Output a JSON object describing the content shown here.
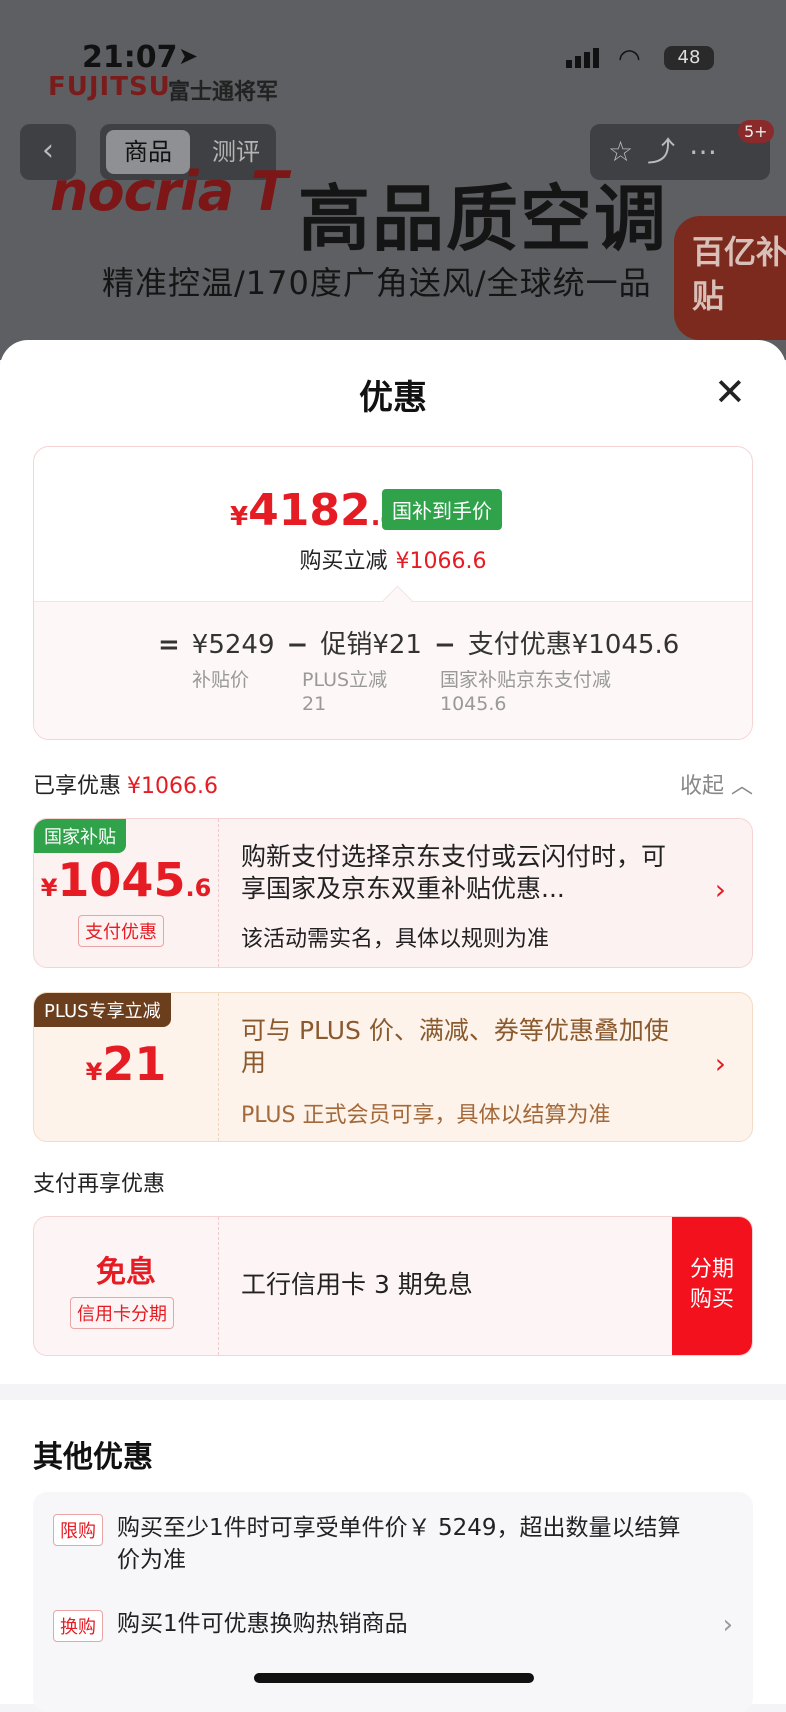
{
  "background": {
    "status_time": "21:07",
    "battery": "48",
    "brand": "FUJITSU",
    "brand_cn": "富士通将军",
    "tab_product": "商品",
    "tab_review": "测评",
    "cart_badge": "5+",
    "logo_text": "nocria T",
    "headline": "高品质空调",
    "subline": "精准控温/170度广角送风/全球统一品",
    "subsidy_tag": "百亿补贴"
  },
  "sheet": {
    "title": "优惠",
    "summary": {
      "currency": "¥",
      "final_int": "4182",
      "final_dec": ".4",
      "final_tag": "国补到手价",
      "reduce_label": "购买立减",
      "reduce_amount": "¥1066.6",
      "formula_eq": "=",
      "base_price": "¥5249",
      "minus": "−",
      "promo": "促销¥21",
      "pay_discount": "支付优惠¥1045.6",
      "base_label": "补贴价",
      "promo_label_1": "PLUS立减",
      "promo_label_2": "21",
      "pay_label_1": "国家补贴京东支付减",
      "pay_label_2": "1045.6"
    },
    "enjoyed_label": "已享优惠",
    "enjoyed_amount": "¥1066.6",
    "collapse_label": "收起",
    "subsidy_card": {
      "label": "国家补贴",
      "currency": "¥",
      "amount_int": "1045",
      "amount_dec": ".6",
      "tag": "支付优惠",
      "desc": "购新支付选择京东支付或云闪付时，可享国家及京东双重补贴优惠...",
      "note": "该活动需实名，具体以规则为准"
    },
    "plus_card": {
      "label": "PLUS专享立减",
      "currency": "¥",
      "amount": "21",
      "desc": "可与 PLUS 价、满减、券等优惠叠加使用",
      "note": "PLUS 正式会员可享，具体以结算为准"
    },
    "pay_again_title": "支付再享优惠",
    "installment_card": {
      "title": "免息",
      "tag": "信用卡分期",
      "desc": "工行信用卡 3 期免息",
      "button_line1": "分期",
      "button_line2": "购买"
    },
    "other_title": "其他优惠",
    "other_items": [
      {
        "tag": "限购",
        "text": "购买至少1件时可享受单件价￥ 5249，超出数量以结算价为准"
      },
      {
        "tag": "换购",
        "text": "购买1件可优惠换购热销商品"
      }
    ]
  },
  "colors": {
    "accent_red": "#e51c23",
    "green_tag": "#2fa24a",
    "plus_brown": "#6b3e1e"
  }
}
